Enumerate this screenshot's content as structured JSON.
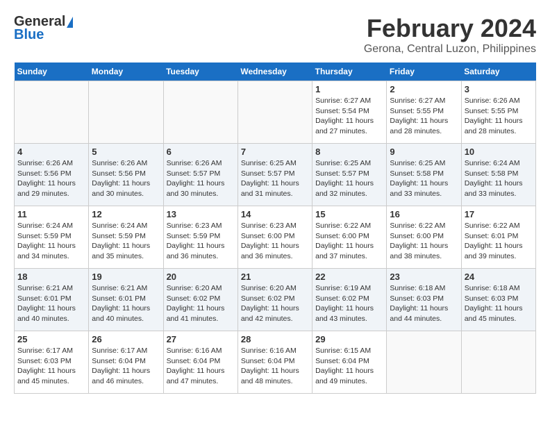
{
  "header": {
    "logo_general": "General",
    "logo_blue": "Blue",
    "month_year": "February 2024",
    "location": "Gerona, Central Luzon, Philippines"
  },
  "weekdays": [
    "Sunday",
    "Monday",
    "Tuesday",
    "Wednesday",
    "Thursday",
    "Friday",
    "Saturday"
  ],
  "weeks": [
    [
      {
        "day": "",
        "info": ""
      },
      {
        "day": "",
        "info": ""
      },
      {
        "day": "",
        "info": ""
      },
      {
        "day": "",
        "info": ""
      },
      {
        "day": "1",
        "info": "Sunrise: 6:27 AM\nSunset: 5:54 PM\nDaylight: 11 hours and 27 minutes."
      },
      {
        "day": "2",
        "info": "Sunrise: 6:27 AM\nSunset: 5:55 PM\nDaylight: 11 hours and 28 minutes."
      },
      {
        "day": "3",
        "info": "Sunrise: 6:26 AM\nSunset: 5:55 PM\nDaylight: 11 hours and 28 minutes."
      }
    ],
    [
      {
        "day": "4",
        "info": "Sunrise: 6:26 AM\nSunset: 5:56 PM\nDaylight: 11 hours and 29 minutes."
      },
      {
        "day": "5",
        "info": "Sunrise: 6:26 AM\nSunset: 5:56 PM\nDaylight: 11 hours and 30 minutes."
      },
      {
        "day": "6",
        "info": "Sunrise: 6:26 AM\nSunset: 5:57 PM\nDaylight: 11 hours and 30 minutes."
      },
      {
        "day": "7",
        "info": "Sunrise: 6:25 AM\nSunset: 5:57 PM\nDaylight: 11 hours and 31 minutes."
      },
      {
        "day": "8",
        "info": "Sunrise: 6:25 AM\nSunset: 5:57 PM\nDaylight: 11 hours and 32 minutes."
      },
      {
        "day": "9",
        "info": "Sunrise: 6:25 AM\nSunset: 5:58 PM\nDaylight: 11 hours and 33 minutes."
      },
      {
        "day": "10",
        "info": "Sunrise: 6:24 AM\nSunset: 5:58 PM\nDaylight: 11 hours and 33 minutes."
      }
    ],
    [
      {
        "day": "11",
        "info": "Sunrise: 6:24 AM\nSunset: 5:59 PM\nDaylight: 11 hours and 34 minutes."
      },
      {
        "day": "12",
        "info": "Sunrise: 6:24 AM\nSunset: 5:59 PM\nDaylight: 11 hours and 35 minutes."
      },
      {
        "day": "13",
        "info": "Sunrise: 6:23 AM\nSunset: 5:59 PM\nDaylight: 11 hours and 36 minutes."
      },
      {
        "day": "14",
        "info": "Sunrise: 6:23 AM\nSunset: 6:00 PM\nDaylight: 11 hours and 36 minutes."
      },
      {
        "day": "15",
        "info": "Sunrise: 6:22 AM\nSunset: 6:00 PM\nDaylight: 11 hours and 37 minutes."
      },
      {
        "day": "16",
        "info": "Sunrise: 6:22 AM\nSunset: 6:00 PM\nDaylight: 11 hours and 38 minutes."
      },
      {
        "day": "17",
        "info": "Sunrise: 6:22 AM\nSunset: 6:01 PM\nDaylight: 11 hours and 39 minutes."
      }
    ],
    [
      {
        "day": "18",
        "info": "Sunrise: 6:21 AM\nSunset: 6:01 PM\nDaylight: 11 hours and 40 minutes."
      },
      {
        "day": "19",
        "info": "Sunrise: 6:21 AM\nSunset: 6:01 PM\nDaylight: 11 hours and 40 minutes."
      },
      {
        "day": "20",
        "info": "Sunrise: 6:20 AM\nSunset: 6:02 PM\nDaylight: 11 hours and 41 minutes."
      },
      {
        "day": "21",
        "info": "Sunrise: 6:20 AM\nSunset: 6:02 PM\nDaylight: 11 hours and 42 minutes."
      },
      {
        "day": "22",
        "info": "Sunrise: 6:19 AM\nSunset: 6:02 PM\nDaylight: 11 hours and 43 minutes."
      },
      {
        "day": "23",
        "info": "Sunrise: 6:18 AM\nSunset: 6:03 PM\nDaylight: 11 hours and 44 minutes."
      },
      {
        "day": "24",
        "info": "Sunrise: 6:18 AM\nSunset: 6:03 PM\nDaylight: 11 hours and 45 minutes."
      }
    ],
    [
      {
        "day": "25",
        "info": "Sunrise: 6:17 AM\nSunset: 6:03 PM\nDaylight: 11 hours and 45 minutes."
      },
      {
        "day": "26",
        "info": "Sunrise: 6:17 AM\nSunset: 6:04 PM\nDaylight: 11 hours and 46 minutes."
      },
      {
        "day": "27",
        "info": "Sunrise: 6:16 AM\nSunset: 6:04 PM\nDaylight: 11 hours and 47 minutes."
      },
      {
        "day": "28",
        "info": "Sunrise: 6:16 AM\nSunset: 6:04 PM\nDaylight: 11 hours and 48 minutes."
      },
      {
        "day": "29",
        "info": "Sunrise: 6:15 AM\nSunset: 6:04 PM\nDaylight: 11 hours and 49 minutes."
      },
      {
        "day": "",
        "info": ""
      },
      {
        "day": "",
        "info": ""
      }
    ]
  ]
}
